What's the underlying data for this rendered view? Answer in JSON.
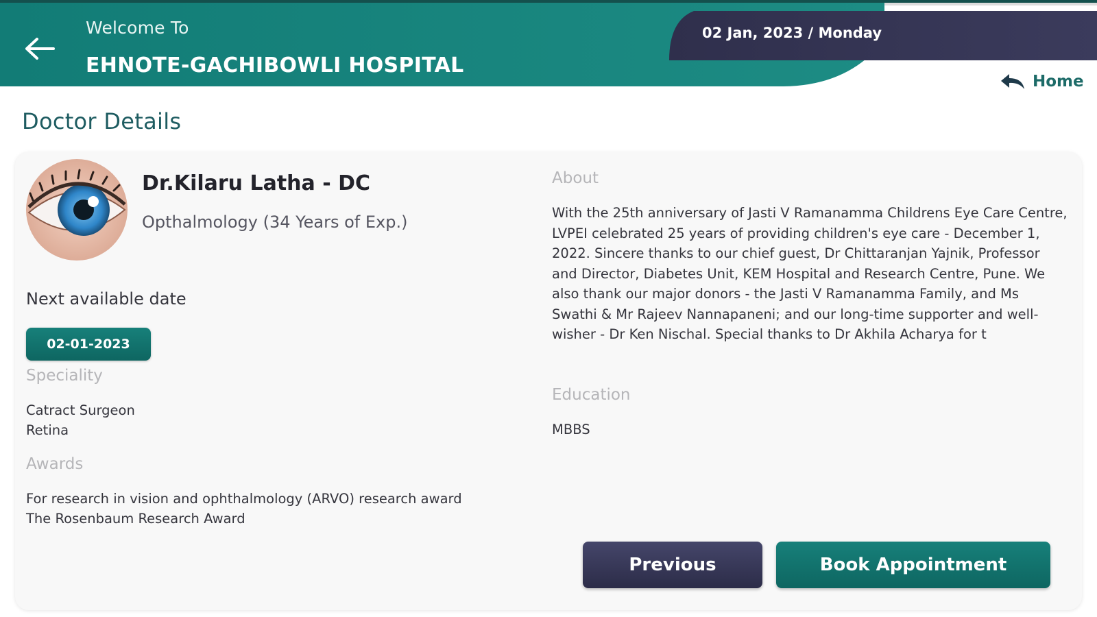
{
  "header": {
    "welcome": "Welcome To",
    "hospital": "EHNOTE-GACHIBOWLI HOSPITAL",
    "date": "02 Jan, 2023 / Monday",
    "home_label": "Home"
  },
  "page": {
    "title": "Doctor Details"
  },
  "doctor": {
    "name": "Dr.Kilaru Latha - DC",
    "department": "Opthalmology (34 Years of Exp.)",
    "next_available_label": "Next available date",
    "next_available_date": "02-01-2023",
    "speciality_label": "Speciality",
    "specialities": [
      "Catract Surgeon",
      "Retina"
    ],
    "awards_label": "Awards",
    "awards": [
      "For research in vision and ophthalmology (ARVO) research award",
      "The Rosenbaum Research Award"
    ],
    "about_label": "About",
    "about": "With the 25th anniversary of Jasti V Ramanamma Childrens Eye Care Centre, LVPEI celebrated 25 years of providing children's eye care - December 1, 2022. Sincere thanks to our chief guest, Dr Chittaranjan Yajnik, Professor and Director, Diabetes Unit, KEM Hospital and Research Centre, Pune. We also thank our major donors - the Jasti V Ramanamma Family, and Ms Swathi & Mr Rajeev Nannapaneni; and our long-time supporter and well-wisher - Dr Ken Nischal. Special thanks to Dr Akhila Acharya for t",
    "education_label": "Education",
    "education": "MBBS"
  },
  "actions": {
    "previous": "Previous",
    "book": "Book Appointment"
  },
  "icons": {
    "back": "arrow-left-icon",
    "home": "reply-arrow-icon"
  },
  "colors": {
    "teal": "#0e6661",
    "navy": "#2c2c48",
    "title_teal": "#1e5c61"
  }
}
